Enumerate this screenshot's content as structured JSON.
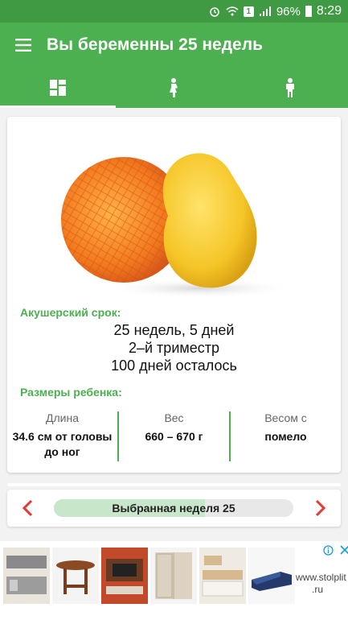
{
  "status_bar": {
    "battery": "96%",
    "time": "8:29",
    "notif_badge": "1"
  },
  "app_bar": {
    "title": "Вы беременны 25 недель"
  },
  "tabs": [
    {
      "name": "overview",
      "icon": "dashboard-icon",
      "active": true
    },
    {
      "name": "mother",
      "icon": "pregnant-woman-icon",
      "active": false
    },
    {
      "name": "baby",
      "icon": "child-icon",
      "active": false
    }
  ],
  "card": {
    "term_label": "Акушерский срок:",
    "term_lines": [
      "25 недель, 5 дней",
      "2–й триместр",
      "100 дней осталось"
    ],
    "sizes_label": "Размеры ребенка:",
    "sizes": [
      {
        "heading": "Длина",
        "value": "34.6 см от головы до ног"
      },
      {
        "heading": "Вес",
        "value": "660 – 670 г"
      },
      {
        "heading": "Весом с",
        "value": "помело"
      }
    ]
  },
  "week_selector": {
    "label": "Выбранная неделя 25",
    "progress": 0.63
  },
  "ad": {
    "text_line1": "www.stolplit",
    "text_line2": ".ru"
  },
  "colors": {
    "primary": "#4caf50",
    "status_bar": "#3f9a43",
    "accent_red": "#e53935"
  }
}
